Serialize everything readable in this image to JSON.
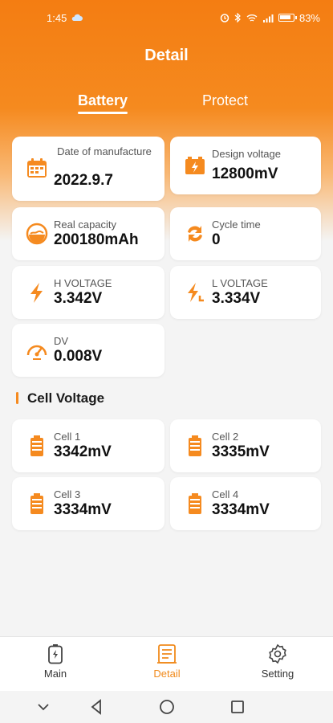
{
  "status_bar": {
    "time": "1:45",
    "battery_percent": "83%"
  },
  "header": {
    "title": "Detail",
    "tabs": [
      {
        "label": "Battery",
        "active": true
      },
      {
        "label": "Protect",
        "active": false
      }
    ]
  },
  "info_cards": [
    {
      "label": "Date of manufacture",
      "value": "2022.9.7",
      "icon": "calendar-icon"
    },
    {
      "label": "Design voltage",
      "value": "12800mV",
      "icon": "battery-charge-icon"
    },
    {
      "label": "Real capacity",
      "value": "200180mAh",
      "icon": "capacity-gauge-icon"
    },
    {
      "label": "Cycle time",
      "value": "0",
      "icon": "cycle-arrows-icon"
    },
    {
      "label": "H VOLTAGE",
      "value": "3.342V",
      "icon": "high-voltage-icon"
    },
    {
      "label": "L VOLTAGE",
      "value": "3.334V",
      "icon": "low-voltage-icon"
    },
    {
      "label": "DV",
      "value": "0.008V",
      "icon": "speedometer-icon"
    }
  ],
  "cell_section": {
    "title": "Cell Voltage",
    "cells": [
      {
        "label": "Cell 1",
        "value": "3342mV"
      },
      {
        "label": "Cell 2",
        "value": "3335mV"
      },
      {
        "label": "Cell 3",
        "value": "3334mV"
      },
      {
        "label": "Cell 4",
        "value": "3334mV"
      }
    ]
  },
  "bottom_nav": [
    {
      "label": "Main",
      "icon": "battery-bolt-icon",
      "active": false
    },
    {
      "label": "Detail",
      "icon": "document-icon",
      "active": true
    },
    {
      "label": "Setting",
      "icon": "gear-icon",
      "active": false
    }
  ],
  "colors": {
    "accent": "#f58a1f",
    "active_nav": "#f08a1c",
    "background": "#f4f4f4"
  }
}
